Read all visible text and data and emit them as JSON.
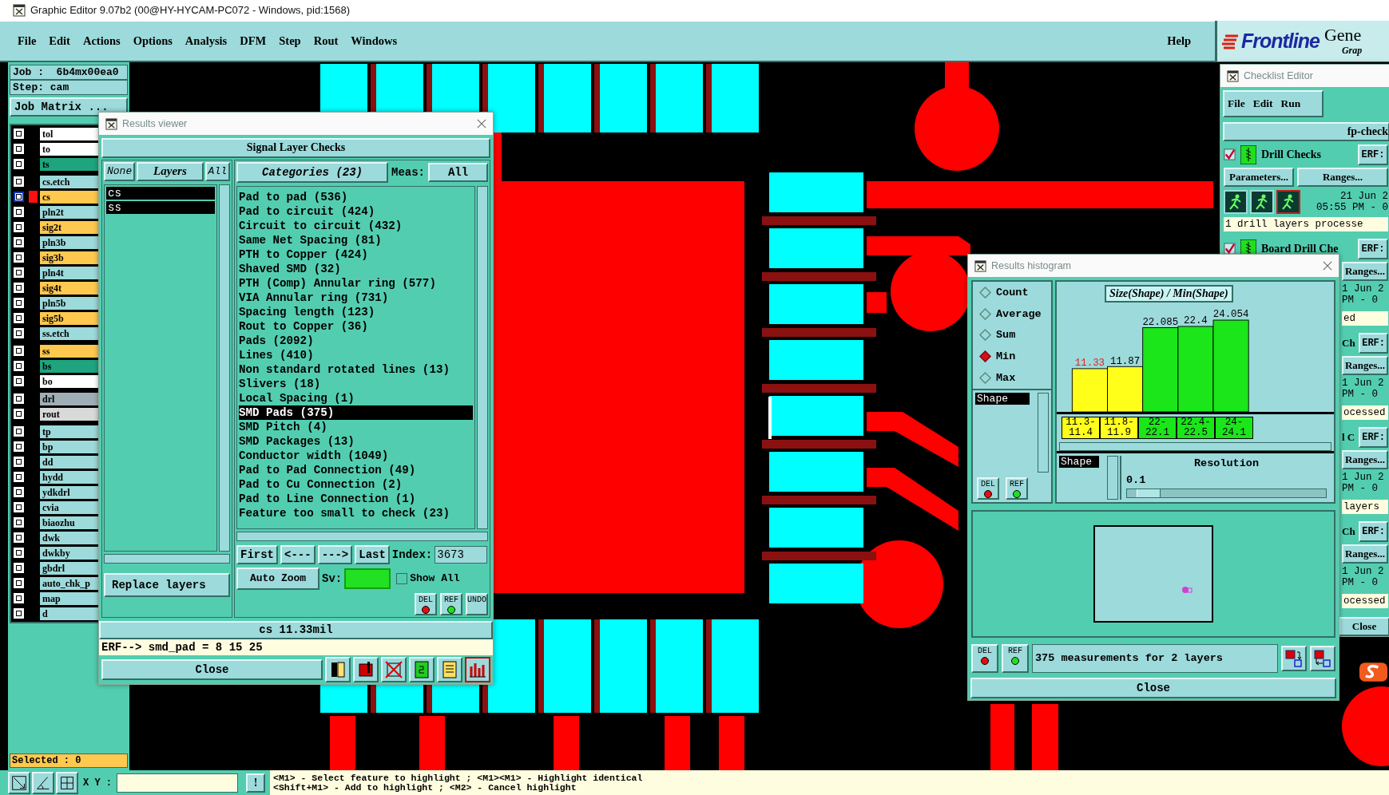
{
  "window": {
    "title": "Graphic Editor 9.07b2 (00@HY-HYCAM-PC072 - Windows, pid:1568)"
  },
  "menu": {
    "items": [
      "File",
      "Edit",
      "Actions",
      "Options",
      "Analysis",
      "DFM",
      "Step",
      "Rout",
      "Windows"
    ],
    "help": "Help"
  },
  "brand": {
    "logo": "Frontline",
    "product": "Gene",
    "subtitle": "Grap"
  },
  "job_panel": {
    "job": "Job :  6b4mx00ea0",
    "step": "Step: cam",
    "matrix_button": "Job Matrix ...",
    "layer_groups": [
      {
        "layers": [
          {
            "name": "tol",
            "color": "#ffffff",
            "checked": true,
            "active": false
          },
          {
            "name": "to",
            "color": "#ffffff",
            "checked": true,
            "active": false
          },
          {
            "name": "ts",
            "color": "#1ea57f",
            "checked": true,
            "active": false
          }
        ]
      },
      {
        "layers": [
          {
            "name": "cs.etch",
            "color": "#9ddadb",
            "checked": true,
            "active": false
          },
          {
            "name": "cs",
            "color": "#ffc94f",
            "checked": true,
            "active": true
          },
          {
            "name": "pln2t",
            "color": "#9ddadb",
            "checked": true,
            "active": false
          },
          {
            "name": "sig2t",
            "color": "#ffc94f",
            "checked": true,
            "active": false
          },
          {
            "name": "pln3b",
            "color": "#9ddadb",
            "checked": true,
            "active": false
          },
          {
            "name": "sig3b",
            "color": "#ffc94f",
            "checked": true,
            "active": false
          },
          {
            "name": "pln4t",
            "color": "#9ddadb",
            "checked": true,
            "active": false
          },
          {
            "name": "sig4t",
            "color": "#ffc94f",
            "checked": true,
            "active": false
          },
          {
            "name": "pln5b",
            "color": "#9ddadb",
            "checked": true,
            "active": false
          },
          {
            "name": "sig5b",
            "color": "#ffc94f",
            "checked": true,
            "active": false
          },
          {
            "name": "ss.etch",
            "color": "#9ddadb",
            "checked": true,
            "active": false
          }
        ]
      },
      {
        "layers": [
          {
            "name": "ss",
            "color": "#ffc94f",
            "checked": true,
            "active": false
          },
          {
            "name": "bs",
            "color": "#1ea57f",
            "checked": true,
            "active": false
          },
          {
            "name": "bo",
            "color": "#ffffff",
            "checked": true,
            "active": false
          }
        ]
      },
      {
        "layers": [
          {
            "name": "drl",
            "color": "#9eaeb4",
            "checked": true,
            "active": false
          },
          {
            "name": "rout",
            "color": "#d9d9d9",
            "checked": true,
            "active": false
          }
        ]
      },
      {
        "layers": [
          {
            "name": "tp",
            "color": "#9ddadb",
            "checked": true,
            "active": false
          },
          {
            "name": "bp",
            "color": "#9ddadb",
            "checked": true,
            "active": false
          },
          {
            "name": "dd",
            "color": "#9ddadb",
            "checked": true,
            "active": false
          },
          {
            "name": "hydd",
            "color": "#9ddadb",
            "checked": true,
            "active": false
          },
          {
            "name": "ydkdrl",
            "color": "#9ddadb",
            "checked": true,
            "active": false
          },
          {
            "name": "cvia",
            "color": "#9ddadb",
            "checked": true,
            "active": false
          },
          {
            "name": "biaozhu",
            "color": "#9ddadb",
            "checked": true,
            "active": false
          },
          {
            "name": "dwk",
            "color": "#9ddadb",
            "checked": true,
            "active": false
          },
          {
            "name": "dwkby",
            "color": "#9ddadb",
            "checked": true,
            "active": false
          },
          {
            "name": "gbdrl",
            "color": "#9ddadb",
            "checked": true,
            "active": false
          },
          {
            "name": "auto_chk_p",
            "color": "#9ddadb",
            "checked": true,
            "active": false
          },
          {
            "name": "map",
            "color": "#9ddadb",
            "checked": true,
            "active": false
          },
          {
            "name": "d",
            "color": "#9ddadb",
            "checked": true,
            "active": false
          }
        ]
      }
    ],
    "selected": "Selected : 0"
  },
  "results_viewer": {
    "title": "Results viewer",
    "heading": "Signal Layer Checks",
    "layer_buttons": [
      "None",
      "Layers",
      "All"
    ],
    "layers": [
      {
        "name": "cs",
        "selected": true
      },
      {
        "name": "ss",
        "selected": true
      }
    ],
    "categories_button": "Categories (23)",
    "meas_label": "Meas:",
    "meas_value": "All",
    "categories": [
      {
        "label": "Pad to pad (536)",
        "selected": false
      },
      {
        "label": "Pad to circuit (424)",
        "selected": false
      },
      {
        "label": "Circuit to circuit (432)",
        "selected": false
      },
      {
        "label": "Same Net Spacing (81)",
        "selected": false
      },
      {
        "label": "PTH to Copper (424)",
        "selected": false
      },
      {
        "label": "Shaved SMD (32)",
        "selected": false
      },
      {
        "label": "PTH (Comp) Annular ring (577)",
        "selected": false
      },
      {
        "label": "VIA Annular ring (731)",
        "selected": false
      },
      {
        "label": "Spacing length (123)",
        "selected": false
      },
      {
        "label": "Rout to Copper (36)",
        "selected": false
      },
      {
        "label": "Pads (2092)",
        "selected": false
      },
      {
        "label": "Lines (410)",
        "selected": false
      },
      {
        "label": "Non standard rotated lines (13)",
        "selected": false
      },
      {
        "label": "Slivers (18)",
        "selected": false
      },
      {
        "label": "Local Spacing (1)",
        "selected": false
      },
      {
        "label": "SMD Pads (375)",
        "selected": true
      },
      {
        "label": "SMD Pitch (4)",
        "selected": false
      },
      {
        "label": "SMD Packages (13)",
        "selected": false
      },
      {
        "label": "Conductor width (1049)",
        "selected": false
      },
      {
        "label": "Pad to Pad Connection (49)",
        "selected": false
      },
      {
        "label": "Pad to Cu Connection (2)",
        "selected": false
      },
      {
        "label": "Pad to Line Connection (1)",
        "selected": false
      },
      {
        "label": "Feature too small to check (23)",
        "selected": false
      }
    ],
    "nav_buttons": [
      "First",
      "<---",
      "--->",
      "Last"
    ],
    "index_label": "Index:",
    "index_value": "3673",
    "zoom_mode": "Auto Zoom",
    "sv_label": "Sv:",
    "show_all": {
      "label": "Show All",
      "checked": false
    },
    "tool_buttons": [
      "DEL",
      "REF",
      "UNDO"
    ],
    "replace_button": "Replace layers",
    "measurement": "cs 11.33mil",
    "erf_line": "ERF--> smd_pad = 8 15 25",
    "close": "Close"
  },
  "histogram": {
    "title": "Results histogram",
    "modes": [
      {
        "kind": "count",
        "label": "Count",
        "selected": false
      },
      {
        "kind": "average",
        "label": "Average",
        "selected": false
      },
      {
        "kind": "sum",
        "label": "Sum",
        "selected": false
      },
      {
        "kind": "min",
        "label": "Min",
        "selected": true
      },
      {
        "kind": "max",
        "label": "Max",
        "selected": false
      }
    ],
    "shape_list": [
      {
        "label": "Shape",
        "selected": true
      }
    ],
    "buttons": [
      "DEL",
      "REF"
    ],
    "chart_data": {
      "type": "bar",
      "title": "Size(Shape) / Min(Shape)",
      "categories": [
        "11.3-11.4",
        "11.8-11.9",
        "22-22.1",
        "22.4-22.5",
        "24-24.1"
      ],
      "series": [
        {
          "color": "#ffff1a",
          "values": [
            11.33,
            11.87,
            null,
            null,
            null
          ]
        },
        {
          "color": "#1ae61a",
          "values": [
            null,
            null,
            22.085,
            22.4,
            24.054
          ]
        }
      ],
      "data_labels": true
    },
    "attribute_list": [
      {
        "label": "Shape",
        "selected": true
      }
    ],
    "resolution": {
      "label": "Resolution",
      "value": "0.1",
      "level": 0.05
    },
    "footer_buttons": [
      "DEL",
      "REF"
    ],
    "summary": "375 measurements for 2 layers",
    "close": "Close"
  },
  "checklist_editor": {
    "title": "Checklist Editor",
    "menu": [
      "File",
      "Edit",
      "Run"
    ],
    "checklist_name": "fp-check",
    "checks": [
      {
        "kind": "full",
        "name": "Drill Checks",
        "checked": true,
        "erf": "ERF:",
        "parameters": "Parameters...",
        "ranges": "Ranges...",
        "date": "21 Jun 2",
        "time": "05:55 PM - 0",
        "status": "1 drill layers processe"
      },
      {
        "kind": "top",
        "name": "Board Drill Che",
        "checked": true,
        "erf": "ERF:",
        "ranges": "Ranges...",
        "date": "1 Jun 2",
        "time": "PM - 0",
        "status": "ed"
      },
      {
        "kind": "clipped",
        "name": "Ch",
        "erf": "ERF:",
        "ranges": "Ranges...",
        "date": "1 Jun 2",
        "time": "PM - 0",
        "status": "ocessed"
      },
      {
        "kind": "clipped",
        "name": "l C",
        "erf": "ERF:",
        "ranges": "Ranges...",
        "date": "1 Jun 2",
        "time": "PM - 0",
        "status": "layers"
      },
      {
        "kind": "clipped",
        "name": "Ch",
        "erf": "ERF:",
        "ranges": "Ranges...",
        "date": "1 Jun 2",
        "time": "PM - 0",
        "status": "ocessed"
      }
    ],
    "close": "Close"
  },
  "bottom_bar": {
    "coord_label": "X Y :",
    "alert_button": "!",
    "hints": [
      "<M1> - Select feature to highlight ; <M1><M1> - Highlight identical",
      "<Shift+M1> - Add to highlight ; <M2> - Cancel highlight"
    ]
  }
}
